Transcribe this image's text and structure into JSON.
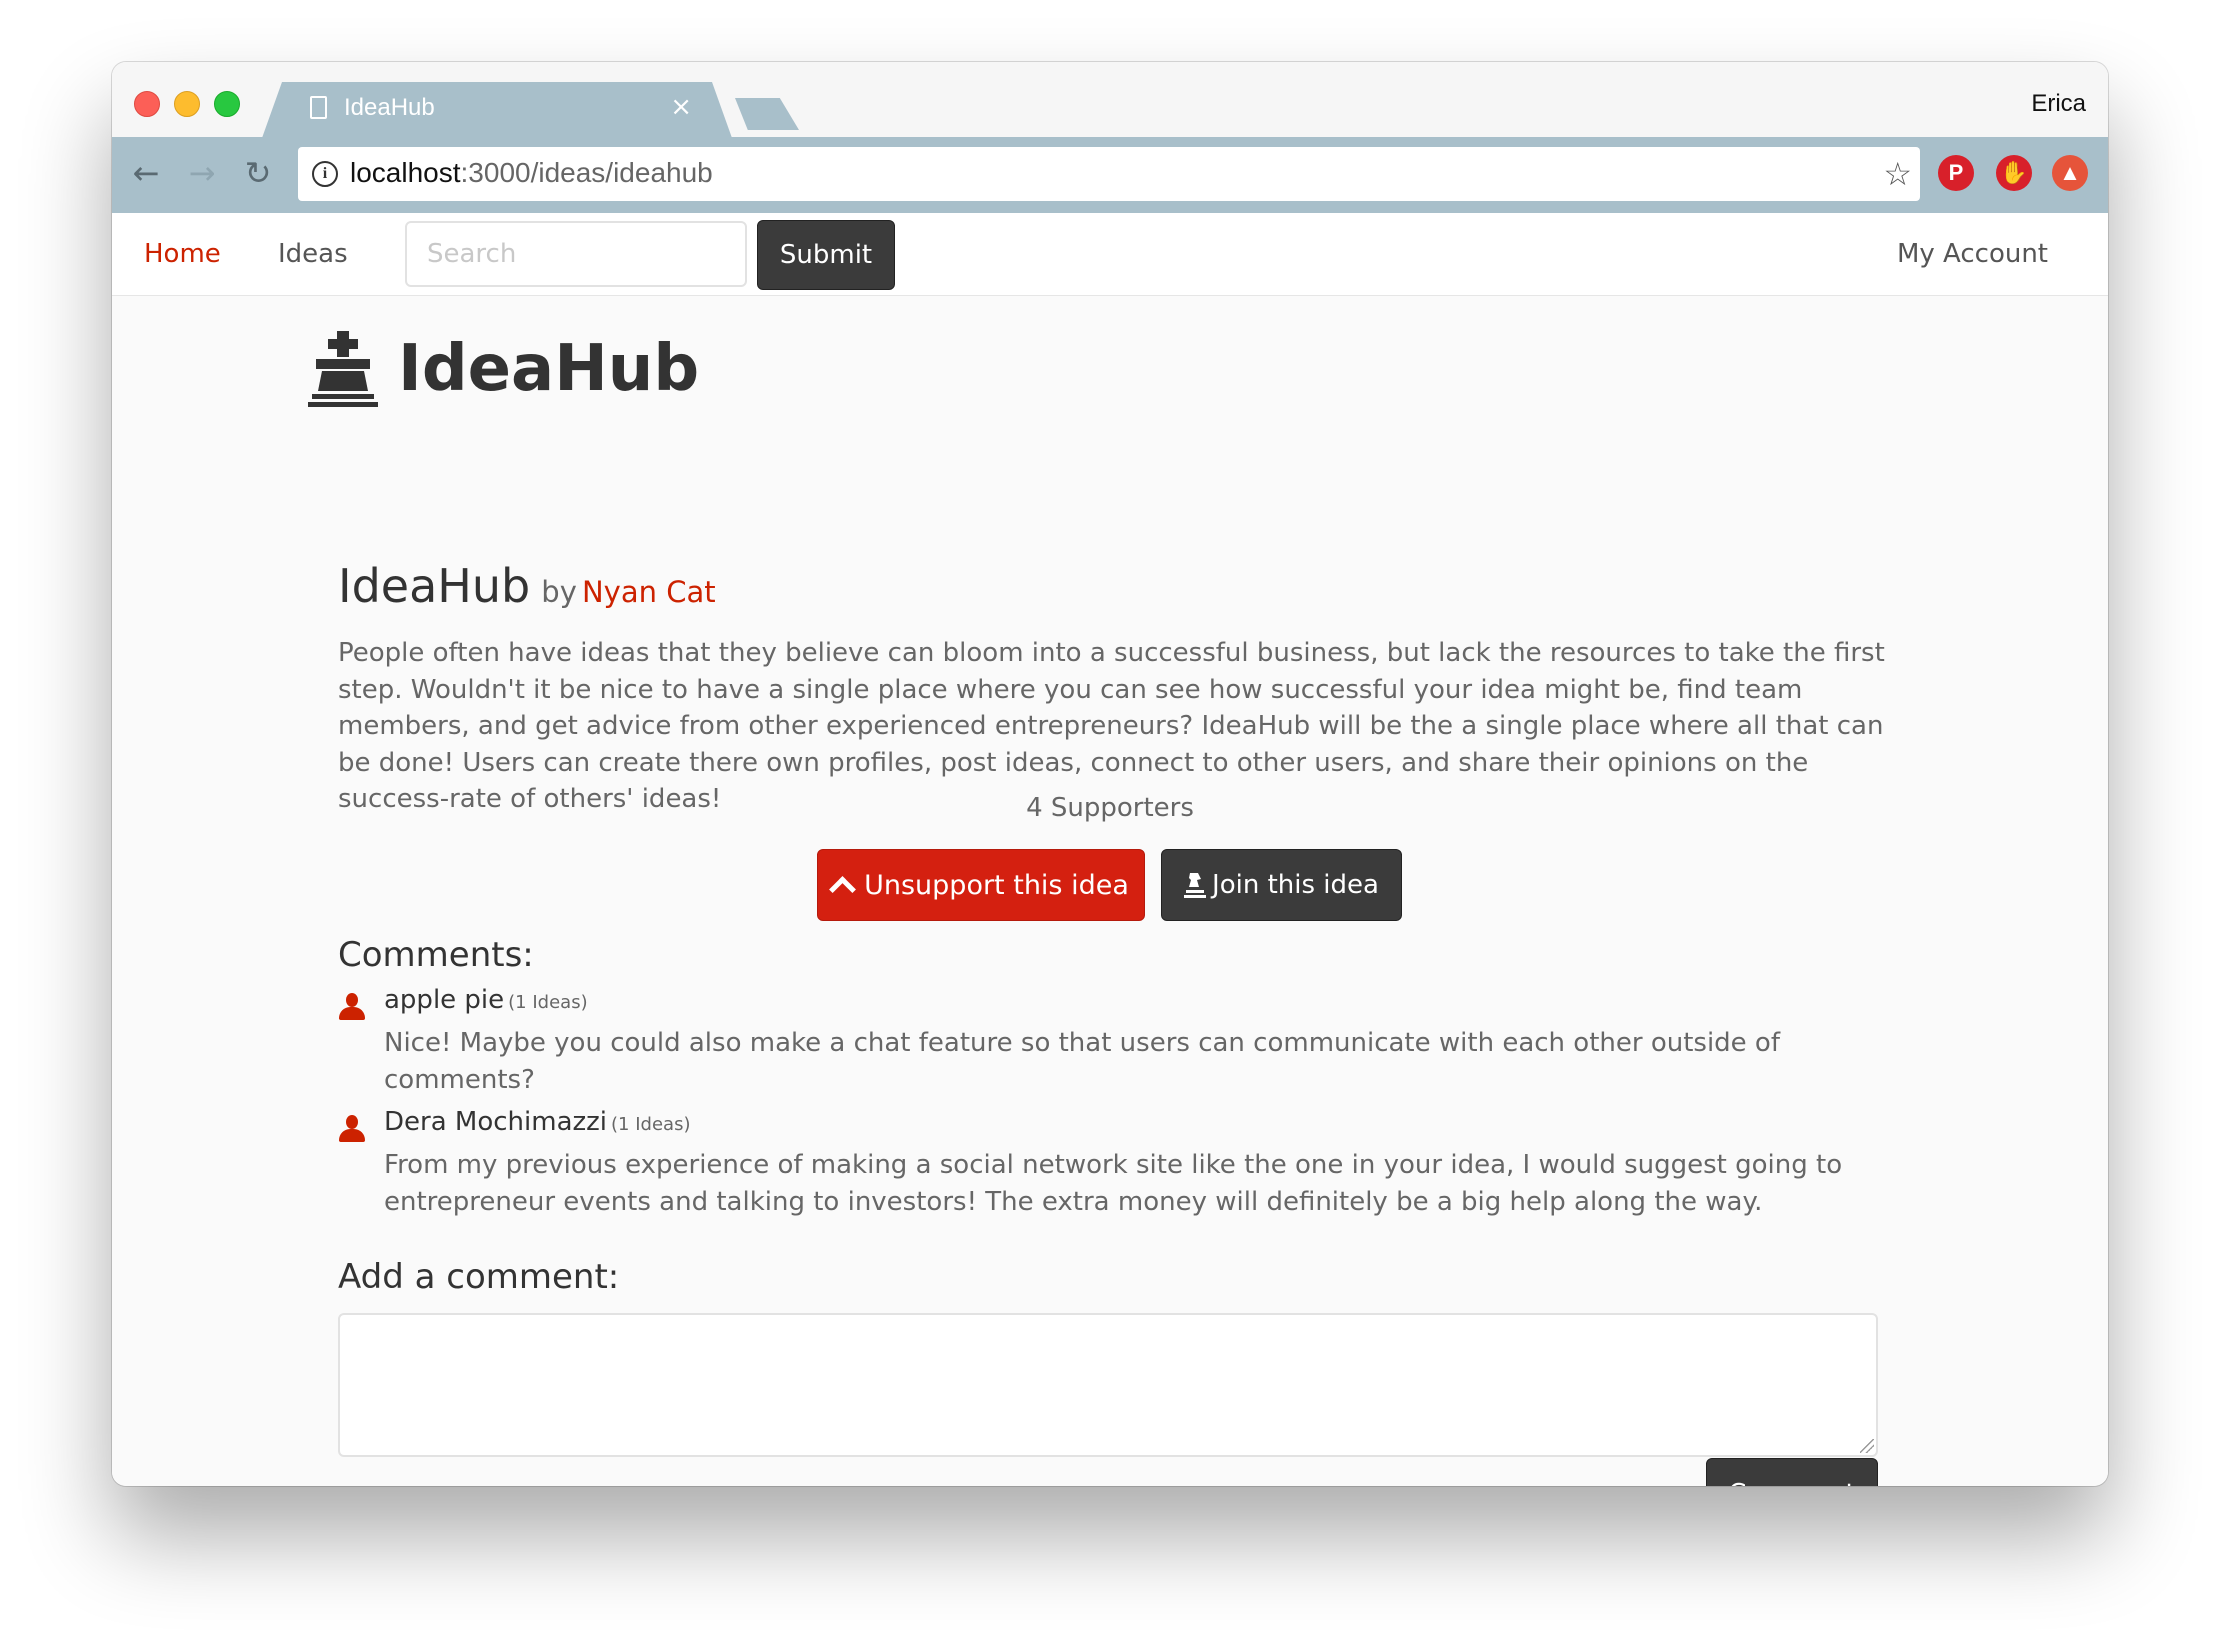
{
  "browser": {
    "tab_title": "IdeaHub",
    "tab_close": "×",
    "profile_name": "Erica",
    "url_host": "localhost",
    "url_rest": ":3000/ideas/ideahub",
    "icons": [
      "back-arrow-icon",
      "forward-arrow-icon",
      "reload-icon",
      "info-icon",
      "star-icon",
      "pinterest-icon",
      "adblock-hand-icon",
      "upload-arrow-icon"
    ]
  },
  "navbar": {
    "home_label": "Home",
    "ideas_label": "Ideas",
    "search_placeholder": "Search",
    "search_value": "",
    "submit_label": "Submit",
    "account_label": "My Account"
  },
  "hero": {
    "title": "IdeaHub",
    "icon": "chess-king-icon"
  },
  "idea": {
    "title": "IdeaHub",
    "by": "by",
    "author": "Nyan Cat",
    "description": "People often have ideas that they believe can bloom into a successful business, but lack the resources to take the first step. Wouldn't it be nice to have a single place where you can see how successful your idea might be, find team members, and get advice from other experienced entrepreneurs? IdeaHub will be the a single place where all that can be done! Users can create there own profiles, post ideas, connect to other users, and share their opinions on the success-rate of others' ideas!",
    "supporters": "4 Supporters",
    "unsupport_label": "Unsupport this idea",
    "join_label": "Join this idea"
  },
  "comments": {
    "heading": "Comments:",
    "items": [
      {
        "author": "apple pie",
        "meta": "(1 Ideas)",
        "text": "Nice! Maybe you could also make a chat feature so that users can communicate with each other outside of comments?"
      },
      {
        "author": "Dera Mochimazzi",
        "meta": "(1 Ideas)",
        "text": "From my previous experience of making a social network site like the one in your idea, I would suggest going to entrepreneur events and talking to investors! The extra money will definitely be a big help along the way."
      }
    ]
  },
  "add_comment": {
    "heading": "Add a comment:",
    "value": "",
    "button_label": "Comment"
  },
  "colors": {
    "accent_red": "#cc2200",
    "button_red": "#d42010",
    "button_dark": "#3b3b3b",
    "chrome_tab": "#a8bfca"
  }
}
